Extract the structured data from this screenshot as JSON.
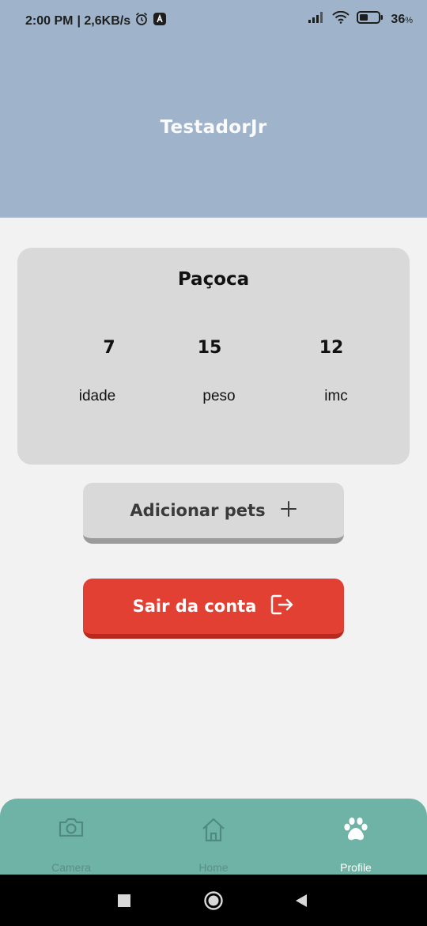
{
  "status_bar": {
    "time": "2:00 PM",
    "network_speed": "| 2,6KB/s",
    "battery_percent": "36",
    "battery_unit": "%",
    "icons": [
      "alarm-icon",
      "app-notification-icon",
      "signal-icon",
      "wifi-icon",
      "battery-icon"
    ]
  },
  "header": {
    "username": "TestadorJr"
  },
  "pet_card": {
    "name": "Paçoca",
    "stats": [
      {
        "value": "7",
        "label": "idade"
      },
      {
        "value": "15",
        "label": "peso"
      },
      {
        "value": "12",
        "label": "imc"
      }
    ]
  },
  "actions": {
    "add_pets_label": "Adicionar pets",
    "add_icon": "plus-icon",
    "logout_label": "Sair da conta",
    "logout_icon": "logout-icon"
  },
  "bottom_nav": {
    "items": [
      {
        "label": "Camera",
        "icon": "camera-icon",
        "active": false
      },
      {
        "label": "Home",
        "icon": "home-icon",
        "active": false
      },
      {
        "label": "Profile",
        "icon": "paw-icon",
        "active": true
      }
    ]
  },
  "system_nav": [
    "recents-button",
    "home-button",
    "back-button"
  ],
  "colors": {
    "header_bg": "#9fb4cb",
    "card_bg": "#d9d9d9",
    "logout_bg": "#e34034",
    "nav_bg": "#6fb3a6"
  }
}
